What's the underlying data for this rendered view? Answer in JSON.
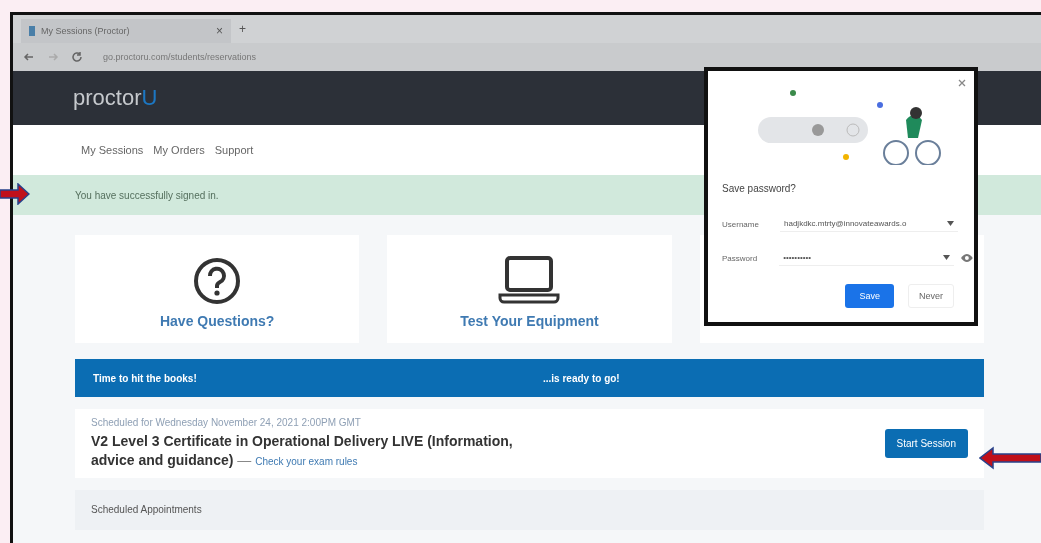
{
  "browser": {
    "tab_title": "My Sessions (Proctor)",
    "tab_close": "×",
    "new_tab": "+",
    "url": "go.proctoru.com/students/reservations"
  },
  "site": {
    "logo": "proctor",
    "logo_accent": "U"
  },
  "nav": [
    {
      "label": "My Sessions"
    },
    {
      "label": "My Orders"
    },
    {
      "label": "Support"
    }
  ],
  "alert": "You have successfully signed in.",
  "cards": [
    {
      "kind": "question",
      "label": "Have Questions?"
    },
    {
      "kind": "laptop",
      "label": "Test Your Equipment"
    },
    {
      "kind": "covered"
    }
  ],
  "banner": {
    "left": "Time to hit the books!",
    "right": "...is ready to go!"
  },
  "session": {
    "scheduled": "Scheduled for Wednesday November 24, 2021 2:00PM GMT",
    "title": "V2 Level 3 Certificate in Operational Delivery LIVE (Information, advice and guidance)",
    "separator": "—",
    "rules_link": "Check your exam rules",
    "button": "Start Session"
  },
  "appointments": {
    "title": "Scheduled Appointments"
  },
  "save_password": {
    "title": "Save password?",
    "username_label": "Username",
    "username": "hadjkdkc.mtrty@innovateawards.o",
    "password_label": "Password",
    "password": "••••••••••",
    "save": "Save",
    "never": "Never"
  }
}
